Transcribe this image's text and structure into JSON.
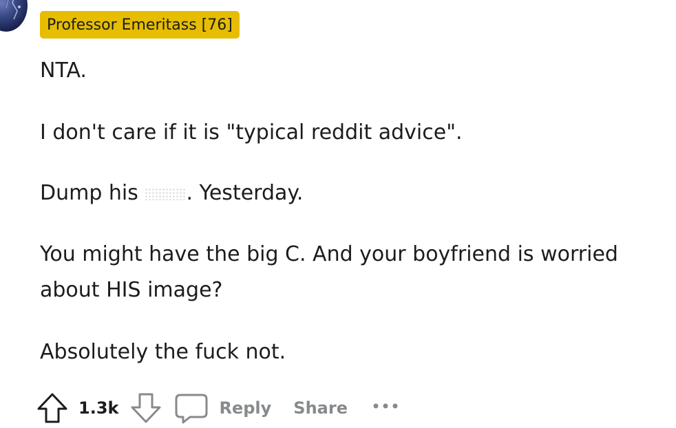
{
  "comment": {
    "author_flair": "Professor Emeritass [76]",
    "paragraphs": {
      "p1": "NTA.",
      "p2": "I don't care if it is \"typical reddit advice\".",
      "p3_before": "Dump his ",
      "p3_after": ". Yesterday.",
      "p4_line1": "You might have the big C. And your boyfriend is worried",
      "p4_line2": "about HIS image?",
      "p5": "Absolutely the fuck not."
    },
    "actions": {
      "vote_count": "1.3k",
      "reply_label": "Reply",
      "share_label": "Share"
    }
  },
  "icons": {
    "upvote": "upvote-arrow-icon",
    "downvote": "downvote-arrow-icon",
    "comment": "comment-bubble-icon",
    "more": "more-dots-icon"
  },
  "colors": {
    "flair_background": "#e6bd00",
    "text": "#1c1c1c",
    "muted_action": "#878a8c"
  }
}
